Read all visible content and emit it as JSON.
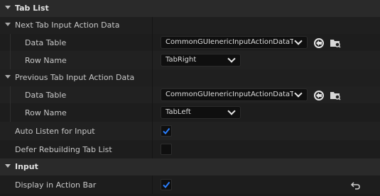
{
  "sections": {
    "tab_list": {
      "label": "Tab List"
    },
    "input": {
      "label": "Input"
    }
  },
  "next_tab": {
    "label": "Next Tab Input Action Data",
    "data_table_label": "Data Table",
    "data_table_value": "CommonGUIenericInputActionDataTat",
    "row_name_label": "Row Name",
    "row_name_value": "TabRight"
  },
  "previous_tab": {
    "label": "Previous Tab Input Action Data",
    "data_table_label": "Data Table",
    "data_table_value": "CommonGUIenericInputActionDataTat",
    "row_name_label": "Row Name",
    "row_name_value": "TabLeft"
  },
  "auto_listen": {
    "label": "Auto Listen for Input",
    "checked": true
  },
  "defer_rebuild": {
    "label": "Defer Rebuilding Tab List",
    "checked": false
  },
  "display_action_bar": {
    "label": "Display in Action Bar",
    "checked": true
  },
  "icons": {
    "use_selected": "use-selected-asset-icon",
    "browse": "browse-asset-folder-icon",
    "reset": "reset-to-default-icon",
    "chevron": "chevron-down-icon",
    "checkmark": "checkmark-icon"
  },
  "colors": {
    "accent": "#2a7fff",
    "background": "#1a1a1a"
  }
}
